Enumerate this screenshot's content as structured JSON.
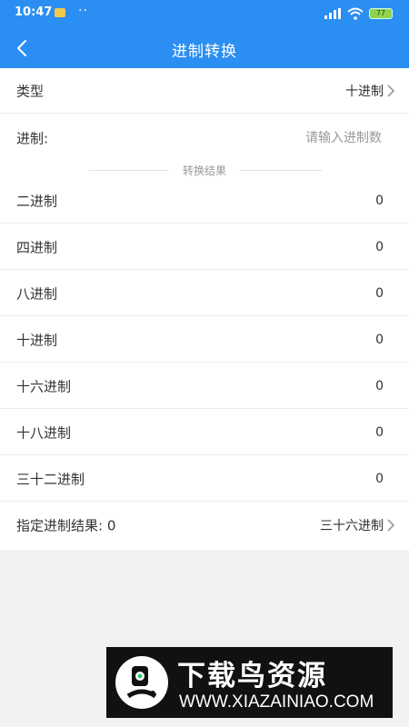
{
  "status_bar": {
    "time": "10:47",
    "dots": "··",
    "battery": "77"
  },
  "header": {
    "title": "进制转换"
  },
  "type_row": {
    "label": "类型",
    "value": "十进制"
  },
  "input_row": {
    "label": "进制:",
    "placeholder": "请输入进制数"
  },
  "result_divider": "转换结果",
  "results": [
    {
      "label": "二进制",
      "value": "0"
    },
    {
      "label": "四进制",
      "value": "0"
    },
    {
      "label": "八进制",
      "value": "0"
    },
    {
      "label": "十进制",
      "value": "0"
    },
    {
      "label": "十六进制",
      "value": "0"
    },
    {
      "label": "十八进制",
      "value": "0"
    },
    {
      "label": "三十二进制",
      "value": "0"
    }
  ],
  "custom_row": {
    "label": "指定进制结果: 0",
    "value": "三十六进制"
  },
  "watermark": {
    "title": "下载鸟资源",
    "url": "WWW.XIAZAINIAO.COM"
  },
  "colors": {
    "primary": "#2b8ef2",
    "background": "#f2f2f2"
  }
}
